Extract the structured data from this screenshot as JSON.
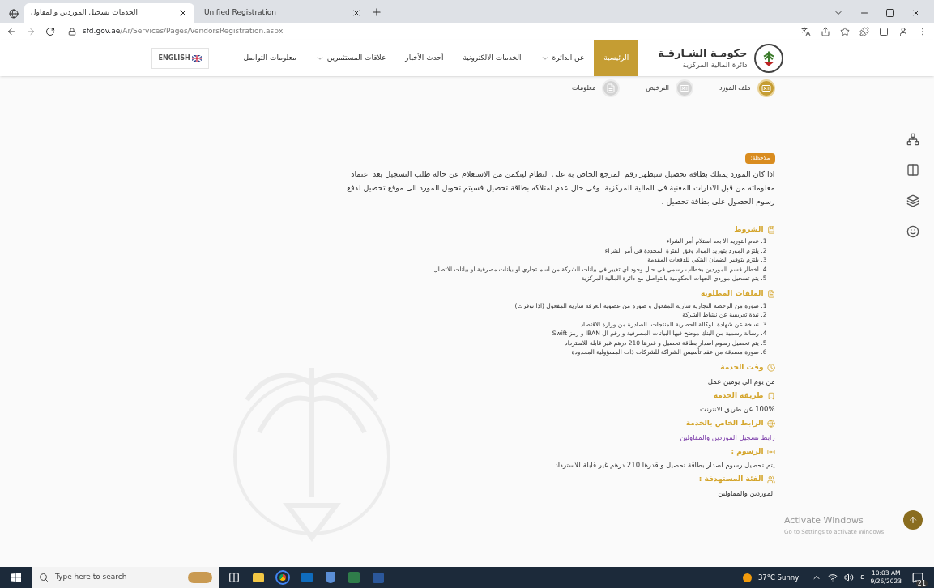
{
  "browser": {
    "left_tab": {
      "title": "الخدمات تسجيل الموردين والمقاول",
      "selected": true
    },
    "right_tab": {
      "title": "Unified Registration",
      "selected": false
    },
    "url_host": "sfd.gov.ae",
    "url_path": "/Ar/Services/Pages/VendorsRegistration.aspx"
  },
  "header": {
    "logo": {
      "title": "حكومـة الشـارقـة",
      "subtitle": "دائرة المالية المركزية"
    },
    "nav": [
      {
        "label": "الرئيسية",
        "selected": true,
        "dropdown": false
      },
      {
        "label": "عن الدائرة",
        "selected": false,
        "dropdown": true
      },
      {
        "label": "الخدمات الالكترونية",
        "selected": false,
        "dropdown": false
      },
      {
        "label": "أحدث الأخبار",
        "selected": false,
        "dropdown": false
      },
      {
        "label": "علاقات المستثمرين",
        "selected": false,
        "dropdown": true
      },
      {
        "label": "معلومات التواصل",
        "selected": false,
        "dropdown": false
      }
    ],
    "language": "ENGLISH"
  },
  "steps": [
    {
      "label": "ملف المورد",
      "selected": true,
      "kind": "card"
    },
    {
      "label": "الترخيص",
      "selected": false,
      "kind": "card"
    },
    {
      "label": "معلومات",
      "selected": false,
      "kind": "file"
    }
  ],
  "note": {
    "badge": "ملاحظة:",
    "text": "اذا كان المورد يمتلك بطاقة تحصيل سيظهر رقم المرجع الخاص به على النظام ليتكمن من الاستعلام عن حالة طلب التسجيل بعد اعتماد معلوماته من قبل الادارات المعنية في المالية المركزية. وفي حال عدم امتلاكه بطاقة تحصيل فسيتم تحويل المورد الى موقع تحصيل لدفع رسوم الحصول على بطاقة تحصيل ."
  },
  "sections": [
    {
      "title": "الشروط",
      "kind": "list",
      "items": [
        "1. عدم التوريد الا بعد استلام أمر الشراء",
        "2. يلتزم المورد بتوريد المواد وفق الفترة المحددة في أمر الشراء",
        "3. يلتزم بتوفير الضمان البنكي للدفعات المقدمة",
        "4. اخطار قسم الموردين بخطاب رسمي في حال وجود اي تغيير في بيانات الشركة من اسم تجاري او بيانات مصرفية او بيانات الاتصال",
        "5. يتم تسجيل موردي الجهات الحكومية بالتواصل مع دائرة المالية المركزية"
      ]
    },
    {
      "title": "الملفات المطلوبة",
      "kind": "list",
      "items": [
        "1. صورة من الرخصة التجارية سارية المفعول و صورة من عضوية الغرفة سارية المفعول (اذا توفرت)",
        "2. نبذة تعريفية عن نشاط الشركة",
        "3. نسخة عن شهادة الوكالة الحصرية للمنتجات، الصادرة من وزارة الاقتصاد",
        "4. رسالة رسمية من البنك موضح فيها البيانات المصرفية و رقم ال IBAN و رمز Swift",
        "5. يتم تحصيل رسوم اصدار بطاقة تحصيل و قدرها 210 درهم غير قابلة للاسترداد",
        "6. صورة مصدقة من عقد تأسيس الشراكة للشركات ذات المسؤولية المحدودة"
      ]
    },
    {
      "title": "وقت الخدمة",
      "kind": "text",
      "text": "من يوم الي يومين عمل"
    },
    {
      "title": "طريقة الخدمة",
      "kind": "text",
      "text": "100% عن طريق الانترنت"
    },
    {
      "title": "الرابط الخاص بالخدمة",
      "kind": "link",
      "text": "رابط تسجيل الموردين والمقاولين"
    },
    {
      "title": "الرسوم :",
      "kind": "text",
      "text": "يتم تحصيل رسوم اصدار بطاقة تحصيل و قدرها 210 درهم غير قابلة للاسترداد"
    },
    {
      "title": "الفئة المستهدفة :",
      "kind": "text",
      "text": "الموردين والمقاولين"
    }
  ],
  "activation": {
    "title": "Activate Windows",
    "subtitle": "Go to Settings to activate Windows."
  },
  "taskbar": {
    "search_placeholder": "Type here to search",
    "weather": "37°C Sunny",
    "input_language": "ε",
    "time": "10:03 AM",
    "date": "9/26/2023",
    "notifications": "21"
  }
}
